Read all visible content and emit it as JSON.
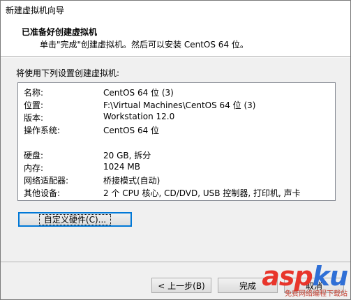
{
  "window": {
    "title": "新建虚拟机向导"
  },
  "header": {
    "title": "已准备好创建虚拟机",
    "subtitle": "单击\"完成\"创建虚拟机。然后可以安装 CentOS 64 位。"
  },
  "intro": "将使用下列设置创建虚拟机:",
  "settings": [
    {
      "key": "名称:",
      "value": "CentOS 64 位 (3)"
    },
    {
      "key": "位置:",
      "value": "F:\\Virtual Machines\\CentOS 64 位 (3)"
    },
    {
      "key": "版本:",
      "value": "Workstation 12.0"
    },
    {
      "key": "操作系统:",
      "value": "CentOS 64 位"
    },
    {
      "key": "硬盘:",
      "value": "20 GB, 拆分"
    },
    {
      "key": "内存:",
      "value": "1024 MB"
    },
    {
      "key": "网络适配器:",
      "value": "桥接模式(自动)"
    },
    {
      "key": "其他设备:",
      "value": "2 个 CPU 核心, CD/DVD, USB 控制器, 打印机, 声卡"
    }
  ],
  "buttons": {
    "customize": "自定义硬件(C)...",
    "back": "< 上一步(B)",
    "finish": "完成",
    "cancel": "取消"
  },
  "watermark": {
    "brand_a": "asp",
    "brand_b": "ku",
    "tagline": "免费网络编程下载站"
  }
}
